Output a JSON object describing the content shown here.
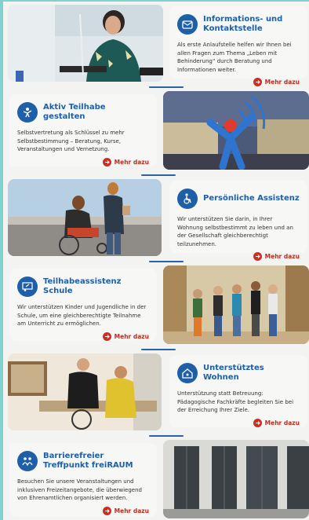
{
  "colors": {
    "accent_blue": "#1f5fa8",
    "accent_red": "#d12c20",
    "background": "#7fd3cf"
  },
  "sections": [
    {
      "title": "Informations- und Kontaktstelle",
      "icon": "info-contact-icon",
      "photo": "woman-at-desk-with-phone",
      "description": "Als erste Anlaufstelle helfen wir Ihnen bei allen Fragen zum Thema „Leben mit Behinderung“ durch Beratung und Informationen weiter.",
      "more_label": "Mehr dazu"
    },
    {
      "title": "Aktiv Teilhabe gestalten",
      "icon": "participation-icon",
      "photo": "town-square-with-logo",
      "description": "Selbstvertretung als Schlüssel zu mehr Selbstbestimmung – Beratung, Kurse, Veranstaltungen und Vernetzung.",
      "more_label": "Mehr dazu"
    },
    {
      "title": "Persönliche Assistenz",
      "icon": "wheelchair-assist-icon",
      "photo": "wheelchair-user-with-assistant",
      "description": "Wir unterstützen Sie darin, in Ihrer Wohnung selbstbestimmt zu leben und an der Gesellschaft gleichberechtigt teilzunehmen.",
      "more_label": "Mehr dazu"
    },
    {
      "title": "Teilhabeassistenz Schule",
      "icon": "school-icon",
      "photo": "children-in-school-hallway",
      "description": "Wir unterstützen Kinder und Jugendliche in der Schule, um eine gleichberechtigte Teilnahme am Unterricht zu ermöglichen.",
      "more_label": "Mehr dazu"
    },
    {
      "title": "Unterstütztes Wohnen",
      "icon": "housing-icon",
      "photo": "two-men-at-table",
      "description": "Unterstützung statt Betreuung: Pädagogische Fachkräfte begleiten Sie bei der Erreichung Ihrer Ziele.",
      "more_label": "Mehr dazu"
    },
    {
      "title": "Barrierefreier Treffpunkt freiRAUM",
      "icon": "meeting-point-icon",
      "photo": "building-facade",
      "description": "Besuchen Sie unsere Veranstaltungen und inklusiven Freizeitangebote, die überwiegend von Ehrenamtlichen organisiert werden.",
      "more_label": "Mehr dazu"
    }
  ]
}
